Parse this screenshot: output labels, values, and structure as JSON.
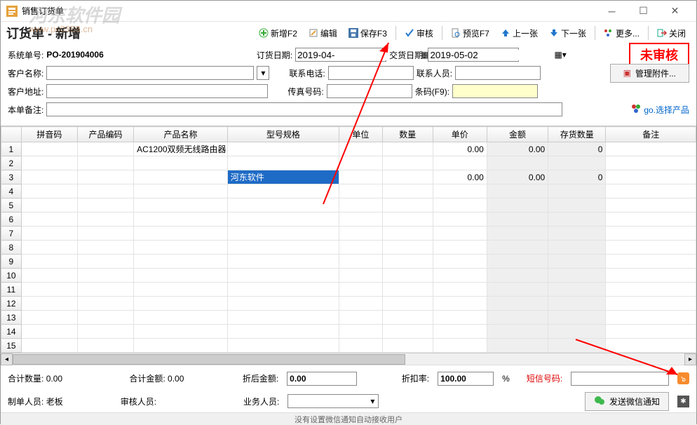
{
  "window": {
    "title": "销售订货单"
  },
  "watermark": {
    "text": "河东软件园",
    "url": "www.pc0359.cn"
  },
  "subtitle": "订货单 - 新增",
  "toolbar": {
    "new": "新增F2",
    "edit": "编辑",
    "save": "保存F3",
    "audit": "审核",
    "preview": "预览F7",
    "prev": "上一张",
    "next": "下一张",
    "more": "更多...",
    "close": "关闭"
  },
  "form": {
    "sysno_label": "系统单号:",
    "sysno": "PO-201904006",
    "orderdate_label": "订货日期:",
    "orderdate": "2019-04-",
    "deliverdate_label": "交货日期:",
    "deliverdate": "2019-05-02",
    "status": "未审核",
    "custname_label": "客户名称:",
    "custname": "",
    "phone_label": "联系电话:",
    "phone": "",
    "contact_label": "联系人员:",
    "contact": "",
    "manage_attach": "管理附件...",
    "custaddr_label": "客户地址:",
    "custaddr": "",
    "fax_label": "传真号码:",
    "fax": "",
    "barcode_label": "条码(F9):",
    "barcode": "",
    "remark_label": "本单备注:",
    "remark": "",
    "select_product": "go.选择产品"
  },
  "grid": {
    "headers": {
      "pinyin": "拼音码",
      "code": "产品编码",
      "name": "产品名称",
      "spec": "型号规格",
      "unit": "单位",
      "qty": "数量",
      "price": "单价",
      "amount": "金额",
      "stock": "存货数量",
      "note": "备注"
    },
    "rows": [
      {
        "n": 1,
        "pinyin": "",
        "code": "",
        "name": "AC1200双频无线路由器",
        "spec": "",
        "unit": "",
        "qty": "",
        "price": "0.00",
        "amount": "0.00",
        "stock": "0",
        "note": ""
      },
      {
        "n": 2,
        "pinyin": "",
        "code": "",
        "name": "",
        "spec": "",
        "unit": "",
        "qty": "",
        "price": "",
        "amount": "",
        "stock": "",
        "note": ""
      },
      {
        "n": 3,
        "pinyin": "",
        "code": "",
        "name": "",
        "spec": "河东软件",
        "spec_selected": true,
        "unit": "",
        "qty": "",
        "price": "0.00",
        "amount": "0.00",
        "stock": "0",
        "note": ""
      },
      {
        "n": 4
      },
      {
        "n": 5
      },
      {
        "n": 6
      },
      {
        "n": 7
      },
      {
        "n": 8
      },
      {
        "n": 9
      },
      {
        "n": 10
      },
      {
        "n": 11
      },
      {
        "n": 12
      },
      {
        "n": 13
      },
      {
        "n": 14
      },
      {
        "n": 15
      }
    ]
  },
  "footer": {
    "totqty_label": "合计数量:",
    "totqty": "0.00",
    "totamt_label": "合计金额:",
    "totamt": "0.00",
    "afterdisc_label": "折后金额:",
    "afterdisc": "0.00",
    "discrate_label": "折扣率:",
    "discrate": "100.00",
    "discrate_unit": "%",
    "sms_label": "短信号码:",
    "sms": "",
    "maker_label": "制单人员:",
    "maker": "老板",
    "auditor_label": "审核人员:",
    "auditor": "",
    "sales_label": "业务人员:",
    "sales": "",
    "wx_btn": "发送微信通知"
  },
  "statusbar": "没有设置微信通知自动接收用户"
}
